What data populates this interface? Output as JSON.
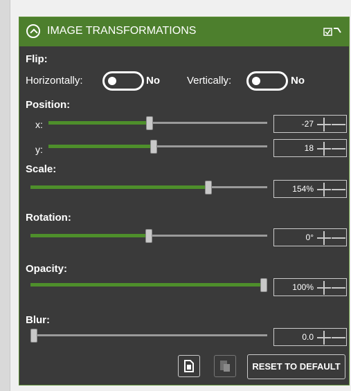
{
  "header": {
    "title": "IMAGE TRANSFORMATIONS"
  },
  "flip": {
    "heading": "Flip:",
    "horizontal_label": "Horizontally:",
    "horizontal_value": "No",
    "vertical_label": "Vertically:",
    "vertical_value": "No"
  },
  "position": {
    "heading": "Position:",
    "x": {
      "label": "x:",
      "value": "-27",
      "fill": 0.46
    },
    "y": {
      "label": "y:",
      "value": "18",
      "fill": 0.48
    }
  },
  "scale": {
    "heading": "Scale:",
    "value": "154%",
    "fill": 0.76
  },
  "rotation": {
    "heading": "Rotation:",
    "value": "0°",
    "fill": 0.5
  },
  "opacity": {
    "heading": "Opacity:",
    "value": "100%",
    "fill": 1.0
  },
  "blur": {
    "heading": "Blur:",
    "value": "0.0",
    "fill": 0.0
  },
  "buttons": {
    "reset_label": "RESET TO DEFAULT"
  },
  "colors": {
    "accent": "#4d7f2d",
    "panel": "#3a3a3a",
    "fill": "#4e8f2b"
  }
}
